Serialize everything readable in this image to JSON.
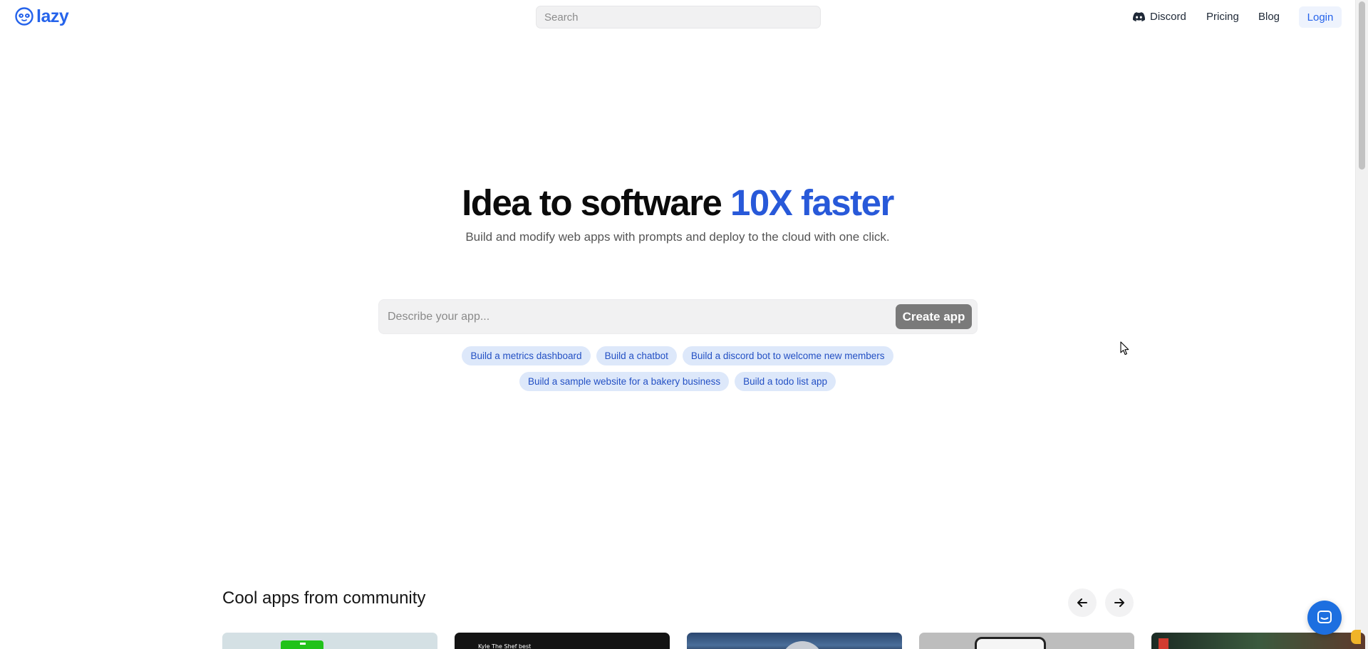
{
  "header": {
    "logo_text": "lazy",
    "search_placeholder": "Search",
    "nav": {
      "discord": "Discord",
      "pricing": "Pricing",
      "blog": "Blog",
      "login": "Login"
    }
  },
  "hero": {
    "title_main": "Idea to software ",
    "title_accent": "10X faster",
    "subtitle": "Build and modify web apps with prompts and deploy to the cloud with one click."
  },
  "prompt": {
    "placeholder": "Describe your app...",
    "create_label": "Create app"
  },
  "suggestions": {
    "row1": [
      "Build a metrics dashboard",
      "Build a chatbot",
      "Build a discord bot to welcome new members"
    ],
    "row2": [
      "Build a sample website for a bakery business",
      "Build a todo list app"
    ]
  },
  "community": {
    "title": "Cool apps from community",
    "card2_text": "Kyle The Shef best"
  },
  "colors": {
    "brand": "#2563eb",
    "accent": "#2859d9",
    "chip_bg": "#dde8fa",
    "create_button": "#7a7a7a"
  }
}
